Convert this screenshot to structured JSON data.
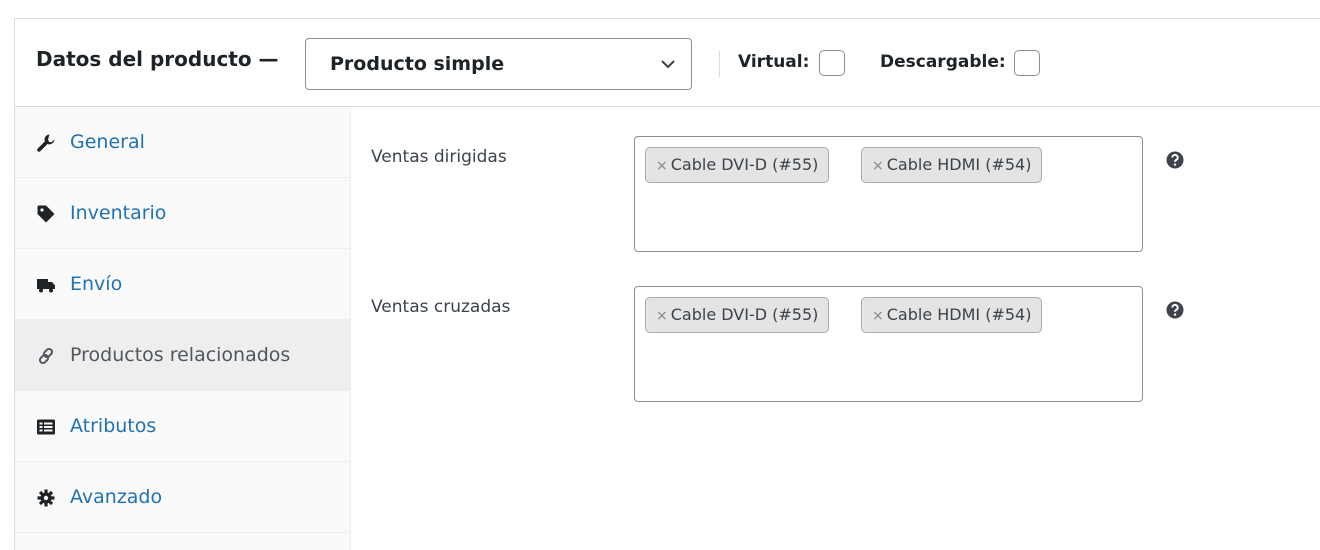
{
  "header": {
    "title": "Datos del producto —",
    "product_type": {
      "selected": "Producto simple",
      "icon": "chevron-down-icon"
    },
    "virtual_label": "Virtual:",
    "downloadable_label": "Descargable:"
  },
  "sidebar": {
    "items": [
      {
        "label": "General",
        "icon": "wrench-icon",
        "active": false
      },
      {
        "label": "Inventario",
        "icon": "tag-icon",
        "active": false
      },
      {
        "label": "Envío",
        "icon": "truck-icon",
        "active": false
      },
      {
        "label": "Productos relacionados",
        "icon": "link-icon",
        "active": true
      },
      {
        "label": "Atributos",
        "icon": "list-icon",
        "active": false
      },
      {
        "label": "Avanzado",
        "icon": "gear-icon",
        "active": false
      }
    ]
  },
  "fields": {
    "upsells": {
      "label": "Ventas dirigidas",
      "chips": [
        "Cable DVI-D (#55)",
        "Cable HDMI (#54)"
      ],
      "remove_glyph": "×"
    },
    "crosssells": {
      "label": "Ventas cruzadas",
      "chips": [
        "Cable DVI-D (#55)",
        "Cable HDMI (#54)"
      ],
      "remove_glyph": "×"
    }
  },
  "colors": {
    "link": "#2271b1",
    "active_tab_bg": "#eeeeee",
    "chip_bg": "#e4e4e4",
    "border": "#8c8f94"
  }
}
